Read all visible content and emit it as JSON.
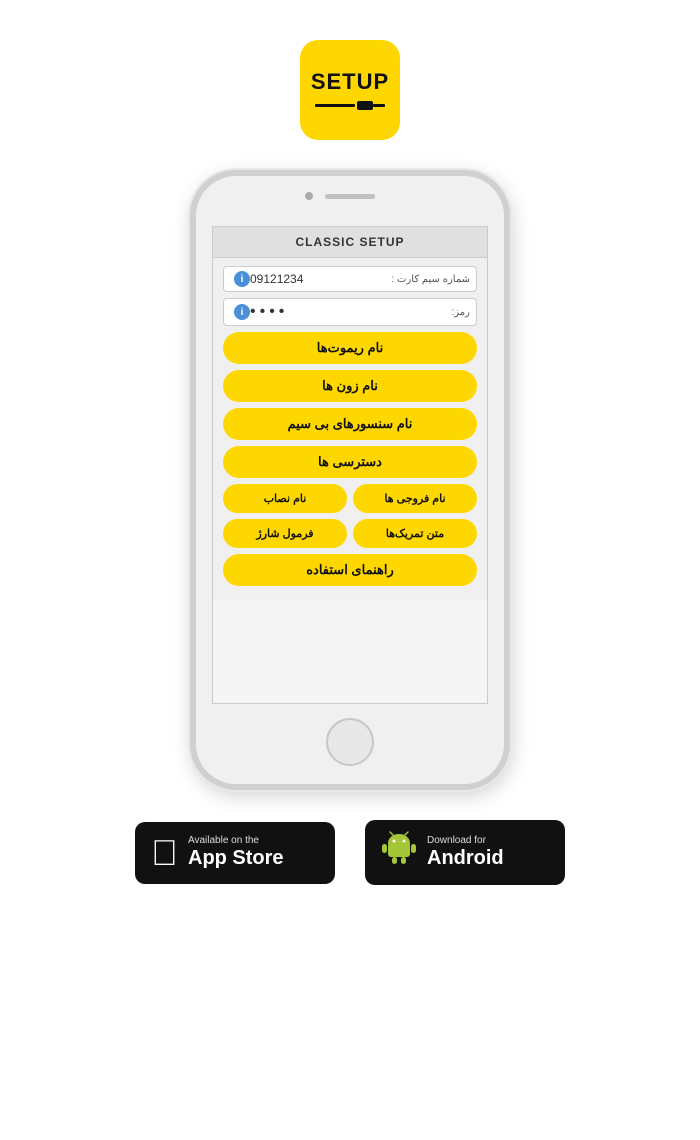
{
  "appIcon": {
    "label": "SETUP"
  },
  "phone": {
    "screenTitle": "CLASSIC SETUP",
    "fields": [
      {
        "label": "شماره سیم کارت :",
        "value": "09121234",
        "type": "text"
      },
      {
        "label": "رمز:",
        "value": "••••",
        "type": "password"
      }
    ],
    "buttons": [
      {
        "label": "نام ریموت‌ها",
        "row": "full"
      },
      {
        "label": "نام زون ها",
        "row": "full"
      },
      {
        "label": "نام سنسورهای بی سیم",
        "row": "full"
      },
      {
        "label": "دسترسی ها",
        "row": "full"
      },
      {
        "label": "نام فروجی ها",
        "row": "half"
      },
      {
        "label": "نام نصاب",
        "row": "half"
      },
      {
        "label": "متن تمریک‌ها",
        "row": "half"
      },
      {
        "label": "فرمول شارژ",
        "row": "half"
      },
      {
        "label": "راهنمای استفاده",
        "row": "full"
      }
    ]
  },
  "badges": {
    "appStore": {
      "smallText": "Available on the",
      "bigText": "App Store"
    },
    "android": {
      "smallText": "Download for",
      "bigText": "Android"
    }
  }
}
